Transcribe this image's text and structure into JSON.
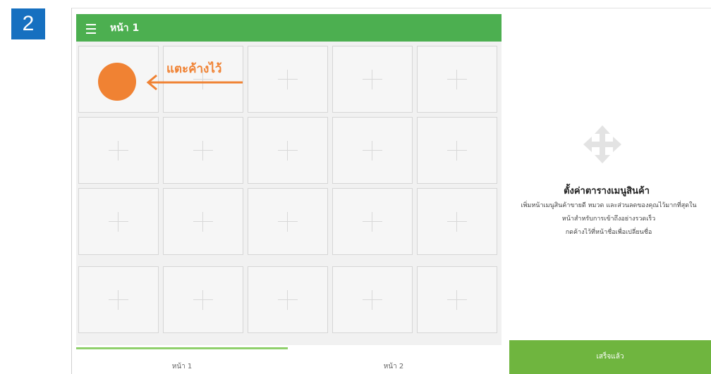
{
  "step_badge": "2",
  "header": {
    "menu_icon": "hamburger-menu-icon",
    "title": "หน้า 1",
    "color": "#4caf50"
  },
  "annotation": {
    "tap_label": "แตะค้างไว้",
    "color": "#f08233"
  },
  "grid": {
    "tile_icon": "plus-icon",
    "rows": 4,
    "columns": 5
  },
  "tabs": [
    {
      "label": "หน้า 1",
      "active": true
    },
    {
      "label": "หน้า 2",
      "active": false
    }
  ],
  "right_panel": {
    "icon": "move-arrows-icon",
    "title": "ตั้งค่าตารางเมนูสินค้า",
    "desc_line1": "เพิ่มหน้าเมนูสินค้าขายดี หมวด และส่วนลดของคุณไว้มากที่สุดใน",
    "desc_line2": "หน้าสำหรับการเข้าถึงอย่างรวดเร็ว",
    "desc_line3": "กดค้างไว้ที่หน้าชื่อเพื่อเปลี่ยนชื่อ",
    "done_label": "เสร็จแล้ว",
    "done_color": "#6fb53f"
  }
}
